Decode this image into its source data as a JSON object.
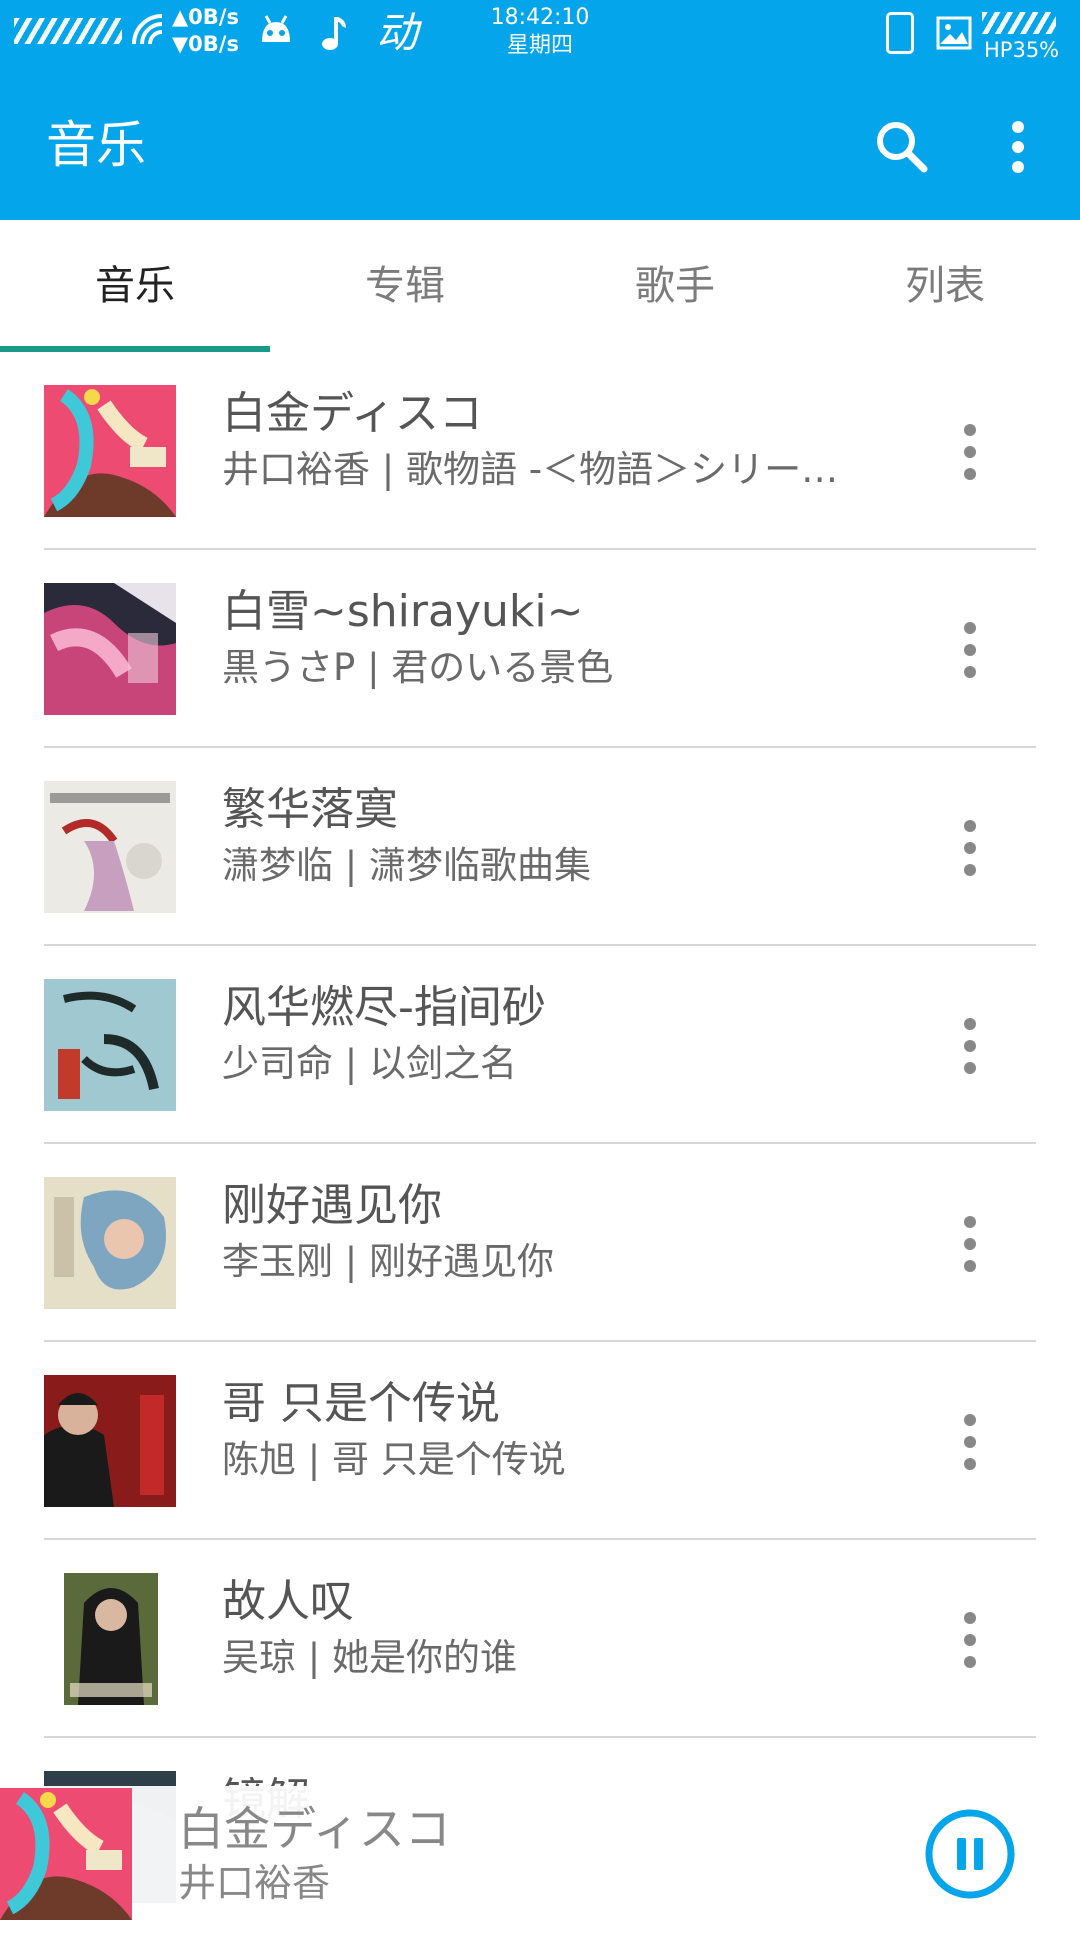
{
  "status_bar": {
    "net_up": "▲0B/s",
    "net_down": "▼0B/s",
    "app_icons": [
      "android-icon",
      "music-note-icon",
      "dong-app-icon"
    ],
    "dong_glyph": "动",
    "time": "18:42:10",
    "weekday": "星期四",
    "battery": "HP35%"
  },
  "app_bar": {
    "title": "音乐",
    "icons": [
      "search-icon",
      "more-vert-icon"
    ]
  },
  "tabs": [
    {
      "label": "音乐",
      "active": true
    },
    {
      "label": "专辑",
      "active": false
    },
    {
      "label": "歌手",
      "active": false
    },
    {
      "label": "列表",
      "active": false
    }
  ],
  "songs": [
    {
      "title": "白金ディスコ",
      "subtitle": "井口裕香 | 歌物語 -＜物語＞シリー…"
    },
    {
      "title": "白雪~shirayuki~",
      "subtitle": "黒うさP | 君のいる景色"
    },
    {
      "title": "繁华落寞",
      "subtitle": "潇梦临 | 潇梦临歌曲集"
    },
    {
      "title": "风华燃尽-指间砂",
      "subtitle": "少司命 | 以剑之名"
    },
    {
      "title": "刚好遇见你",
      "subtitle": "李玉刚 | 刚好遇见你"
    },
    {
      "title": "哥 只是个传说",
      "subtitle": "陈旭 | 哥 只是个传说"
    },
    {
      "title": "故人叹",
      "subtitle": "吴琼 | 她是你的谁"
    },
    {
      "title": "镜解"
    }
  ],
  "now_playing": {
    "title": "白金ディスコ",
    "artist": "井口裕香",
    "state": "playing",
    "control_icon": "pause-icon"
  },
  "colors": {
    "primary": "#04a5ea",
    "tab_indicator": "#1a9b8a",
    "text_primary": "#555555",
    "text_secondary": "#6a6a6a"
  }
}
